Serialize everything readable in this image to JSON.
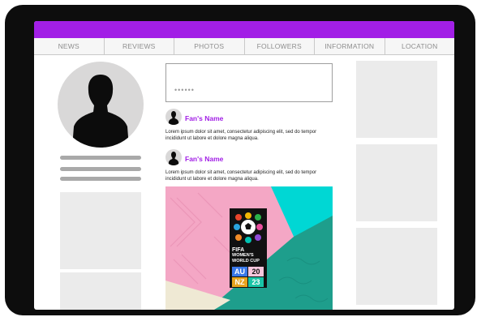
{
  "nav": {
    "items": [
      "NEWS",
      "REVIEWS",
      "PHOTOS",
      "FOLLOWERS",
      "INFORMATION",
      "LOCATION"
    ]
  },
  "composer": {
    "placeholder": "••••••"
  },
  "posts": [
    {
      "author": "Fan's Name",
      "text": "Lorem ipsum dolor sit amet, consectetur adipiscing elit, sed do tempor incididunt ut labore et dolore magna aliqua."
    },
    {
      "author": "Fan's Name",
      "text": "Lorem ipsum dolor sit amet, consectetur adipiscing elit, sed do tempor incididunt ut labore et dolore magna aliqua."
    }
  ],
  "poster": {
    "line1": "FIFA",
    "line2": "WOMEN'S",
    "line3": "WORLD CUP",
    "country_top": "AU",
    "year_top": "20",
    "country_bottom": "NZ",
    "year_bottom": "23"
  },
  "colors": {
    "brand": "#a21fe6",
    "teal": "#1e9e8c",
    "cyan": "#00d7d4",
    "pink": "#f4a7c5",
    "cream": "#efe9d4"
  },
  "icons": [
    "user-silhouette-icon",
    "football-icon"
  ]
}
